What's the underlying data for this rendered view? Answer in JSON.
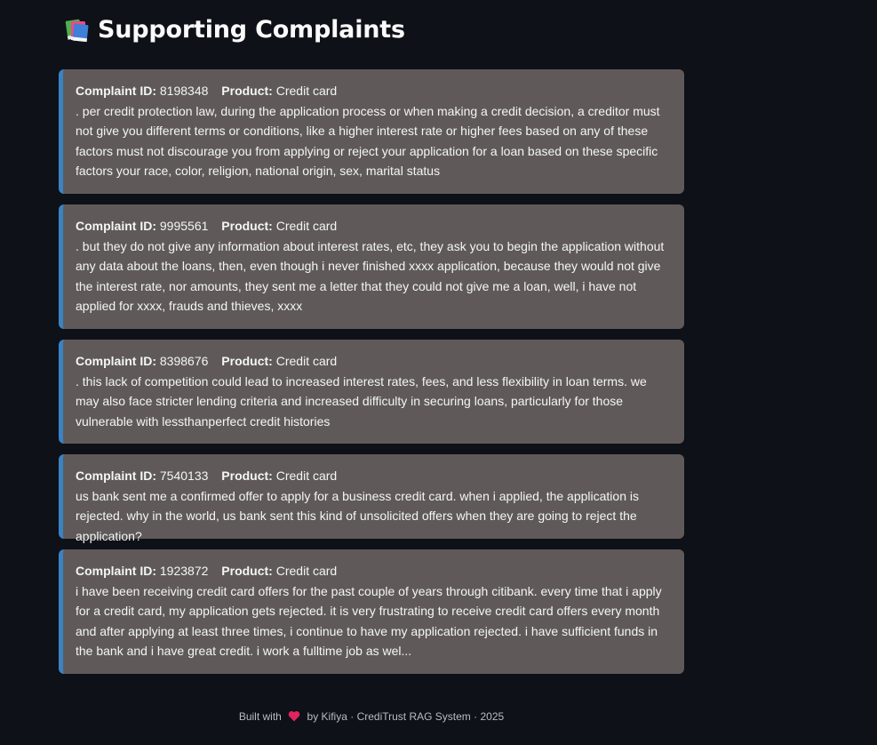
{
  "header": {
    "icon": "books-icon",
    "title": "Supporting Complaints"
  },
  "labels": {
    "complaint_id": "Complaint ID:",
    "product": "Product:"
  },
  "complaints": [
    {
      "id": "8198348",
      "product": "Credit card",
      "text": ". per credit protection law, during the application process or when making a credit decision, a creditor must not give you different terms or conditions, like a higher interest rate or higher fees based on any of these factors must not discourage you from applying or reject your application for a loan based on these specific factors your race, color, religion, national origin, sex, marital status"
    },
    {
      "id": "9995561",
      "product": "Credit card",
      "text": ". but they do not give any information about interest rates, etc, they ask you to begin the application without any data about the loans, then, even though i never finished xxxx application, because they would not give the interest rate, nor amounts, they sent me a letter that they could not give me a loan, well, i have not applied for xxxx, frauds and thieves, xxxx"
    },
    {
      "id": "8398676",
      "product": "Credit card",
      "text": ". this lack of competition could lead to increased interest rates, fees, and less flexibility in loan terms. we may also face stricter lending criteria and increased difficulty in securing loans, particularly for those vulnerable with lessthanperfect credit histories"
    },
    {
      "id": "7540133",
      "product": "Credit card",
      "text": "us bank sent me a confirmed offer to apply for a business credit card. when i applied, the application is rejected. why in the world, us bank sent this kind of unsolicited offers when they are going to reject the application?"
    },
    {
      "id": "1923872",
      "product": "Credit card",
      "text": "i have been receiving credit card offers for the past couple of years through citibank. every time that i apply for a credit card, my application gets rejected. it is very frustrating to receive credit card offers every month and after applying at least three times, i continue to have my application rejected. i have sufficient funds in the bank and i have great credit. i work a fulltime job as wel..."
    }
  ],
  "footer": {
    "prefix": "Built with",
    "heart_icon": "heart-icon",
    "suffix": "by Kifiya · CrediTrust RAG System · 2025"
  },
  "colors": {
    "background": "#0e1117",
    "card": "#5f5a59",
    "card_border": "#3b82c4",
    "heart": "#e0245e"
  }
}
